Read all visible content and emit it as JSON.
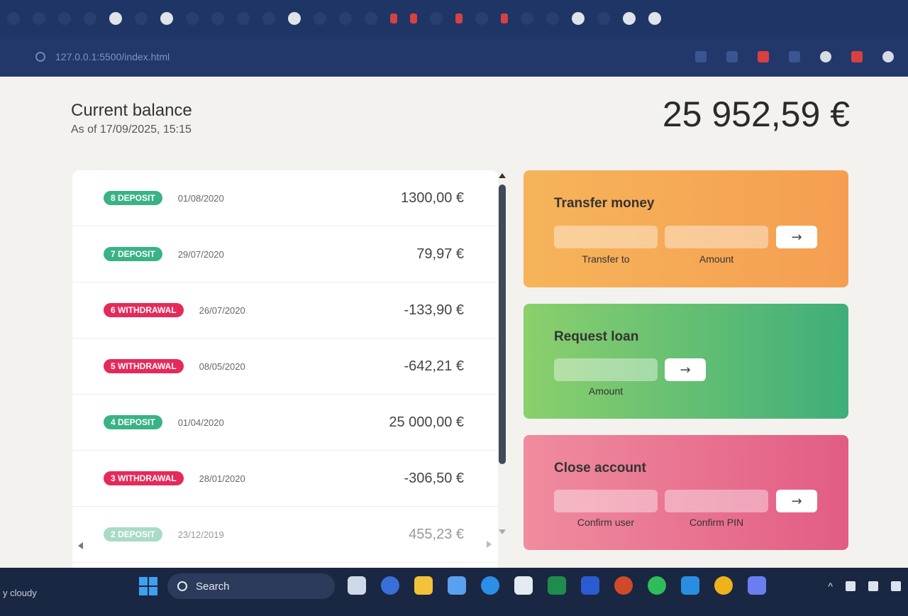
{
  "browser": {
    "url": "127.0.0.1:5500/index.html"
  },
  "balance": {
    "label": "Current balance",
    "date_text": "As of 17/09/2025, 15:15",
    "value": "25 952,59 €"
  },
  "movements": [
    {
      "type_label": "8 DEPOSIT",
      "kind": "deposit",
      "date": "01/08/2020",
      "value": "1300,00 €"
    },
    {
      "type_label": "7 DEPOSIT",
      "kind": "deposit",
      "date": "29/07/2020",
      "value": "79,97 €"
    },
    {
      "type_label": "6 WITHDRAWAL",
      "kind": "withdrawal",
      "date": "26/07/2020",
      "value": "-133,90 €"
    },
    {
      "type_label": "5 WITHDRAWAL",
      "kind": "withdrawal",
      "date": "08/05/2020",
      "value": "-642,21 €"
    },
    {
      "type_label": "4 DEPOSIT",
      "kind": "deposit",
      "date": "01/04/2020",
      "value": "25 000,00 €"
    },
    {
      "type_label": "3 WITHDRAWAL",
      "kind": "withdrawal",
      "date": "28/01/2020",
      "value": "-306,50 €"
    },
    {
      "type_label": "2 DEPOSIT",
      "kind": "deposit",
      "date": "23/12/2019",
      "value": "455,23 €"
    }
  ],
  "operations": {
    "transfer": {
      "title": "Transfer money",
      "to_label": "Transfer to",
      "amount_label": "Amount",
      "button": "→"
    },
    "loan": {
      "title": "Request loan",
      "amount_label": "Amount",
      "button": "→"
    },
    "close": {
      "title": "Close account",
      "user_label": "Confirm user",
      "pin_label": "Confirm PIN",
      "button": "→"
    }
  },
  "taskbar": {
    "weather": "y cloudy",
    "search_label": "Search"
  },
  "colors": {
    "deposit": "#39b385",
    "withdrawal": "#e52a5a",
    "transfer_bg": "#f6b45a",
    "loan_bg": "#5fbf73",
    "close_bg": "#e8708f"
  }
}
